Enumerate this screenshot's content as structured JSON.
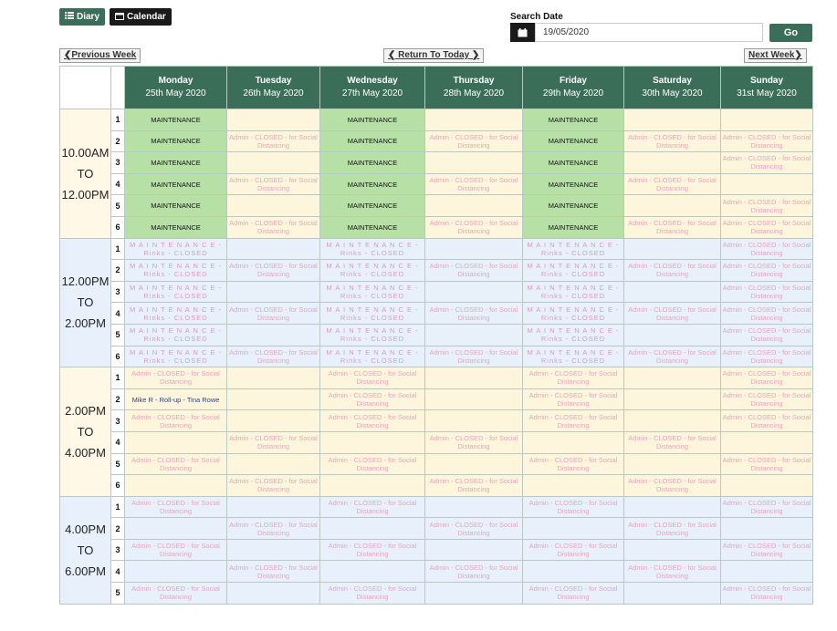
{
  "toolbar": {
    "diary_label": "Diary",
    "calendar_label": "Calendar"
  },
  "search": {
    "label": "Search Date",
    "value": "19/05/2020",
    "go_label": "Go"
  },
  "nav": {
    "prev": "Previous Week",
    "today": "Return To Today",
    "next": "Next Week"
  },
  "days": [
    {
      "name": "Monday",
      "date": "25th May 2020"
    },
    {
      "name": "Tuesday",
      "date": "26th May 2020"
    },
    {
      "name": "Wednesday",
      "date": "27th May 2020"
    },
    {
      "name": "Thursday",
      "date": "28th May 2020"
    },
    {
      "name": "Friday",
      "date": "29th May 2020"
    },
    {
      "name": "Saturday",
      "date": "30th May 2020"
    },
    {
      "name": "Sunday",
      "date": "31st May 2020"
    }
  ],
  "labels": {
    "M": "MAINTENANCE",
    "A": "Admin - CLOSED - for Social Distancing",
    "R": "M A I N T E N A N C E - Rinks - CLOSED",
    "B": "Mike R - Roll-up - Tina Rowe"
  },
  "blocks": [
    {
      "time": [
        "10.00AM",
        "TO",
        "12.00PM"
      ],
      "shade": "yel",
      "rows": [
        "MxMxMx A",
        "MAMAMAA",
        "MxMxMxA",
        "MAMAMA ",
        "MxMxMxA",
        "MAMAMAA"
      ]
    },
    {
      "time": [
        "12.00PM",
        "TO",
        "2.00PM"
      ],
      "shade": "blu",
      "rows": [
        "R R R A",
        "RARARAA",
        "R R R A",
        "RARARAA",
        "R R R A",
        "RARARAA"
      ]
    },
    {
      "time": [
        "2.00PM",
        "TO",
        "4.00PM"
      ],
      "shade": "yel",
      "rows": [
        "A A A A",
        "B A A A",
        "A A A A",
        " A A A ",
        "A A A A",
        " A A A "
      ]
    },
    {
      "time": [
        "4.00PM",
        "TO",
        "6.00PM"
      ],
      "shade": "blu",
      "rows": [
        "A A A A",
        " A A A ",
        "A A A A",
        " A A A ",
        "A A A A"
      ]
    }
  ]
}
